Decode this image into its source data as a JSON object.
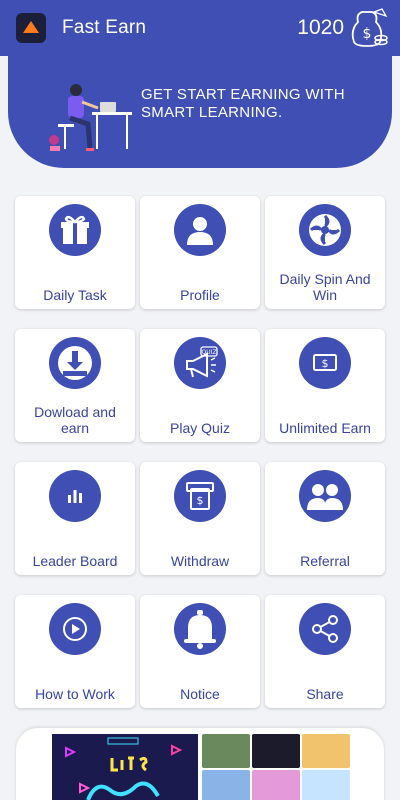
{
  "header": {
    "app_title": "Fast Earn",
    "coin_count": "1020",
    "logo_icon": "app-logo-icon",
    "money_icon": "money-bag-icon"
  },
  "banner": {
    "text": "GET START EARNING WITH SMART LEARNING."
  },
  "menu": [
    {
      "label": "Daily Task",
      "icon": "gift-icon"
    },
    {
      "label": "Profile",
      "icon": "user-icon"
    },
    {
      "label": "Daily Spin And Win",
      "icon": "spin-wheel-icon"
    },
    {
      "label": "Dowload and earn",
      "icon": "download-icon"
    },
    {
      "label": "Play Quiz",
      "icon": "quiz-megaphone-icon"
    },
    {
      "label": "Unlimited Earn",
      "icon": "cash-icon"
    },
    {
      "label": "Leader Board",
      "icon": "bar-chart-icon"
    },
    {
      "label": "Withdraw",
      "icon": "atm-withdraw-icon"
    },
    {
      "label": "Referral",
      "icon": "users-icon"
    },
    {
      "label": "How to Work",
      "icon": "play-circle-icon"
    },
    {
      "label": "Notice",
      "icon": "bell-icon"
    },
    {
      "label": "Share",
      "icon": "share-icon"
    }
  ],
  "colors": {
    "primary": "#3f4fb3",
    "label_text": "#3944a0",
    "background": "#f2f3f7",
    "tile": "#ffffff"
  }
}
